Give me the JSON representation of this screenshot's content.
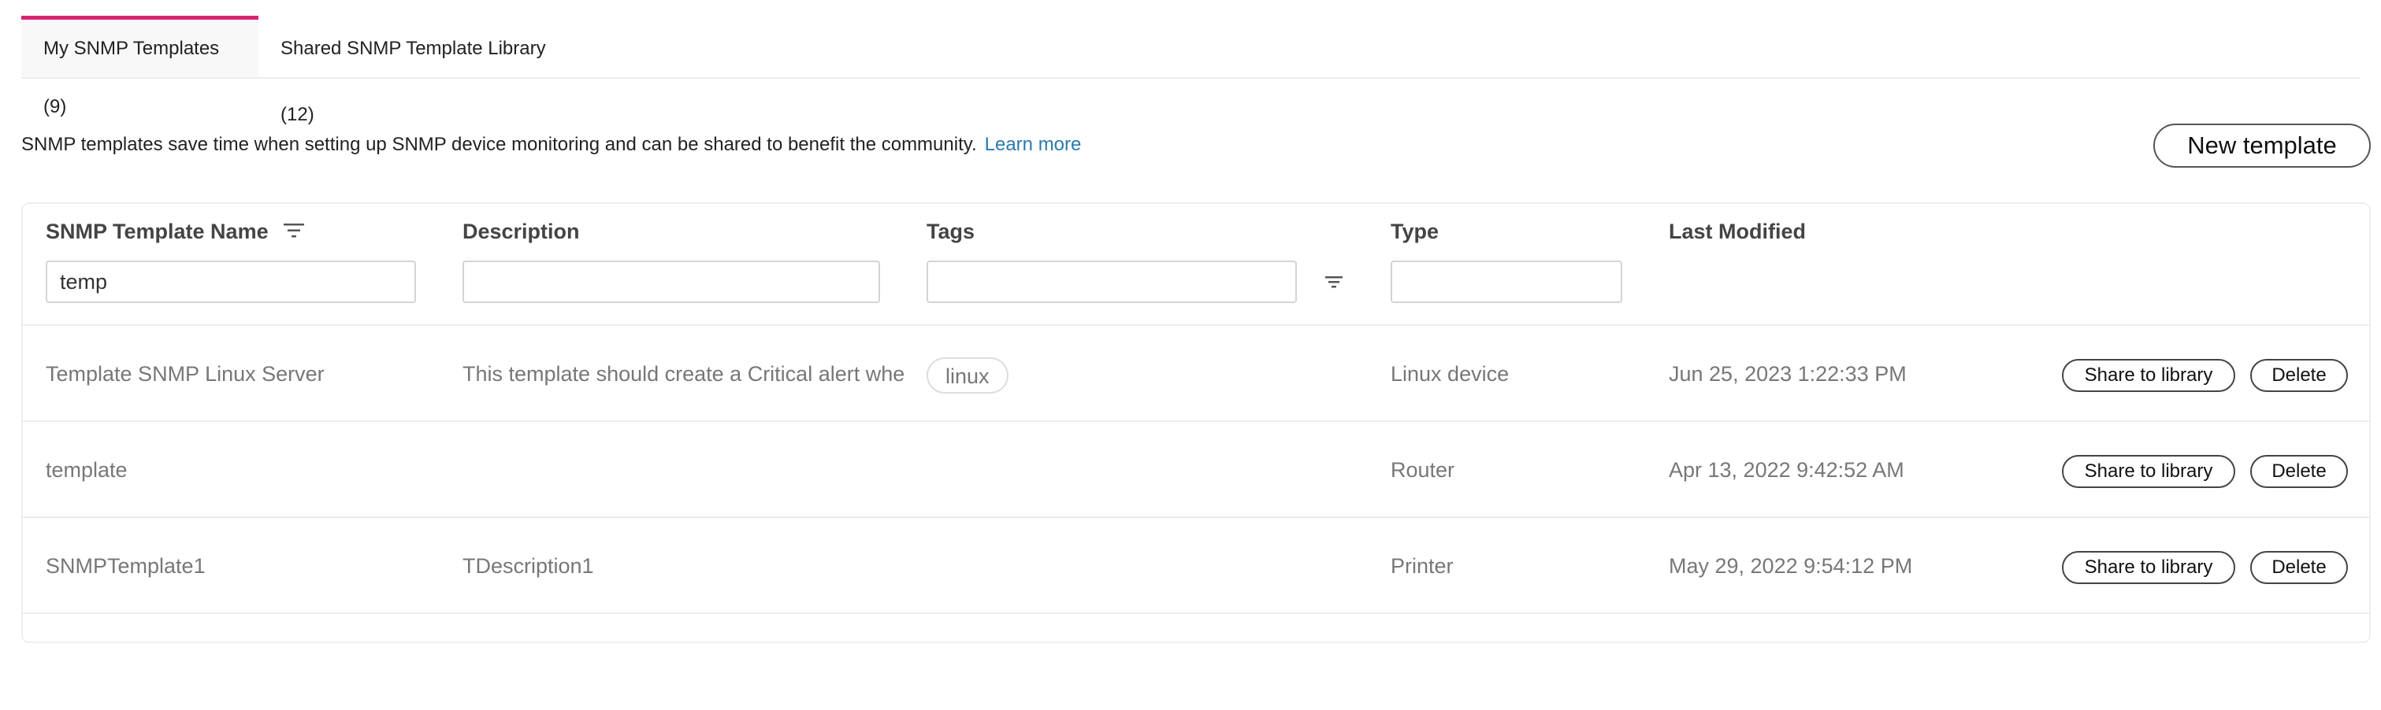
{
  "tabs": [
    {
      "label": "My SNMP Templates (9)",
      "active": true
    },
    {
      "label": "Shared SNMP Template Library (12)",
      "active": false
    }
  ],
  "intro": {
    "text": "SNMP templates save time when setting up SNMP device monitoring and can be shared to benefit the community.",
    "link": "Learn more"
  },
  "toolbar": {
    "new_template_label": "New template"
  },
  "table": {
    "columns": {
      "name": "SNMP Template Name",
      "description": "Description",
      "tags": "Tags",
      "type": "Type",
      "last_modified": "Last Modified"
    },
    "filters": {
      "name": "temp",
      "description": "",
      "tags": "",
      "type": ""
    },
    "rows": [
      {
        "name": "Template SNMP Linux Server",
        "description": "This template should create a Critical alert whe",
        "tag": "linux",
        "type": "Linux device",
        "last_modified": "Jun 25, 2023 1:22:33 PM"
      },
      {
        "name": "template",
        "description": "",
        "tag": "",
        "type": "Router",
        "last_modified": "Apr 13, 2022 9:42:52 AM"
      },
      {
        "name": "SNMPTemplate1",
        "description": "TDescription1",
        "tag": "",
        "type": "Printer",
        "last_modified": "May 29, 2022 9:54:12 PM"
      }
    ],
    "actions": {
      "share_label": "Share to library",
      "delete_label": "Delete"
    }
  },
  "colors": {
    "accent": "#d6246e",
    "link": "#2a7ab0",
    "muted_text": "#777777"
  }
}
